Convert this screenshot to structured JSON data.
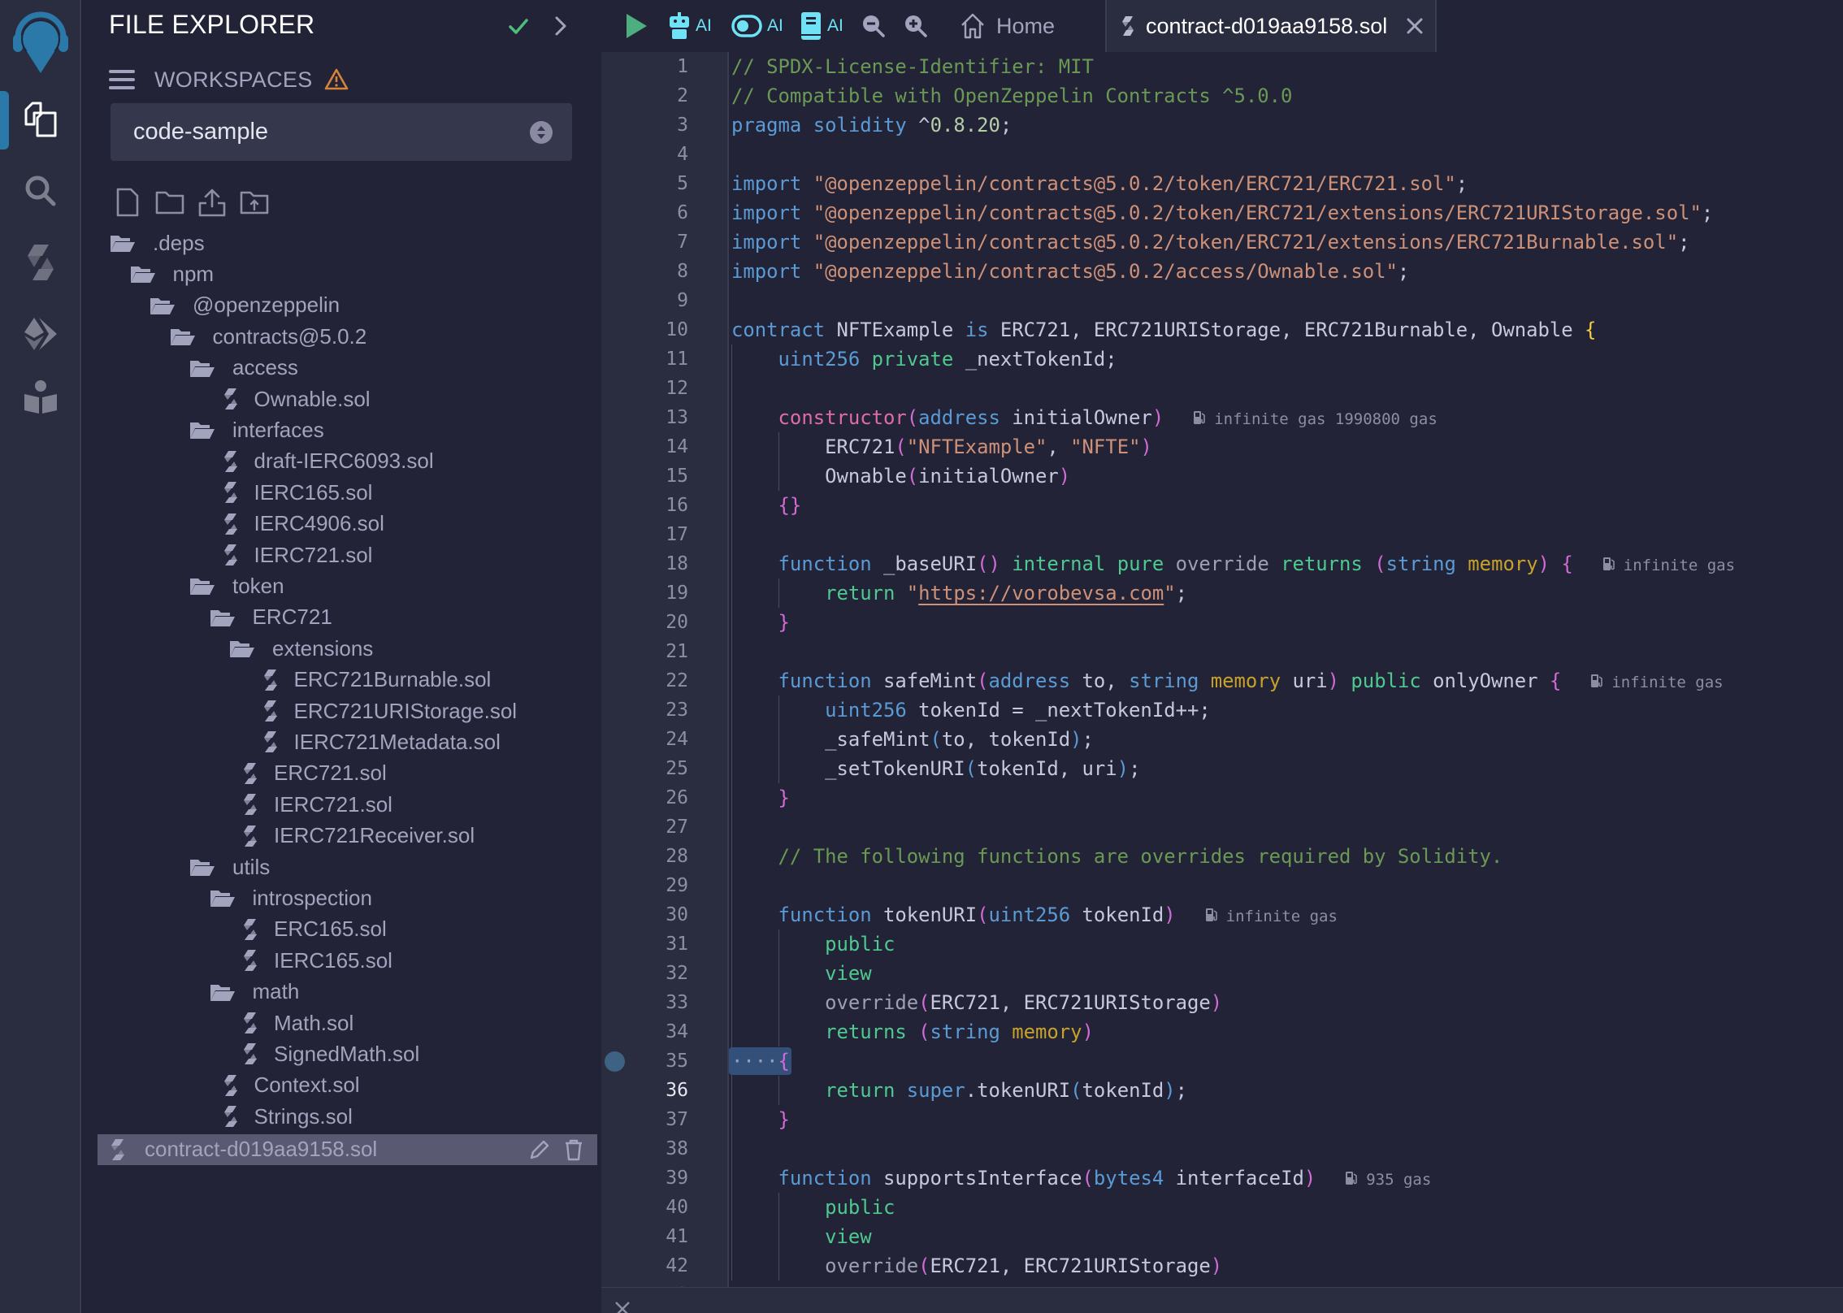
{
  "iconbar": {
    "items": [
      {
        "name": "remix-logo",
        "icon": "remix-logo-icon"
      },
      {
        "name": "file-explorer",
        "icon": "files-icon",
        "active": true
      },
      {
        "name": "search",
        "icon": "search-icon"
      },
      {
        "name": "solidity-compiler",
        "icon": "solidity-icon"
      },
      {
        "name": "deploy-run",
        "icon": "ethereum-deploy-icon"
      },
      {
        "name": "learneth",
        "icon": "learn-book-icon"
      }
    ]
  },
  "sidebar": {
    "title": "FILE EXPLORER",
    "workspaces_label": "WORKSPACES",
    "workspace_selected": "code-sample",
    "colors": {
      "warning": "#d7833a",
      "check": "#4dbd7e",
      "accent": "#2b79a8"
    },
    "file_actions": [
      "new-file",
      "new-folder",
      "upload-file",
      "upload-folder"
    ],
    "tree": [
      {
        "label": ".deps",
        "type": "folder",
        "depth": 0
      },
      {
        "label": "npm",
        "type": "folder",
        "depth": 1
      },
      {
        "label": "@openzeppelin",
        "type": "folder",
        "depth": 2
      },
      {
        "label": "contracts@5.0.2",
        "type": "folder",
        "depth": 3
      },
      {
        "label": "access",
        "type": "folder",
        "depth": 4
      },
      {
        "label": "Ownable.sol",
        "type": "file",
        "depth": 5
      },
      {
        "label": "interfaces",
        "type": "folder",
        "depth": 4
      },
      {
        "label": "draft-IERC6093.sol",
        "type": "file",
        "depth": 5
      },
      {
        "label": "IERC165.sol",
        "type": "file",
        "depth": 5
      },
      {
        "label": "IERC4906.sol",
        "type": "file",
        "depth": 5
      },
      {
        "label": "IERC721.sol",
        "type": "file",
        "depth": 5
      },
      {
        "label": "token",
        "type": "folder",
        "depth": 4
      },
      {
        "label": "ERC721",
        "type": "folder",
        "depth": 5
      },
      {
        "label": "extensions",
        "type": "folder",
        "depth": 6
      },
      {
        "label": "ERC721Burnable.sol",
        "type": "file",
        "depth": 7
      },
      {
        "label": "ERC721URIStorage.sol",
        "type": "file",
        "depth": 7
      },
      {
        "label": "IERC721Metadata.sol",
        "type": "file",
        "depth": 7
      },
      {
        "label": "ERC721.sol",
        "type": "file",
        "depth": 6
      },
      {
        "label": "IERC721.sol",
        "type": "file",
        "depth": 6
      },
      {
        "label": "IERC721Receiver.sol",
        "type": "file",
        "depth": 6
      },
      {
        "label": "utils",
        "type": "folder",
        "depth": 4
      },
      {
        "label": "introspection",
        "type": "folder",
        "depth": 5
      },
      {
        "label": "ERC165.sol",
        "type": "file",
        "depth": 6
      },
      {
        "label": "IERC165.sol",
        "type": "file",
        "depth": 6
      },
      {
        "label": "math",
        "type": "folder",
        "depth": 5
      },
      {
        "label": "Math.sol",
        "type": "file",
        "depth": 6
      },
      {
        "label": "SignedMath.sol",
        "type": "file",
        "depth": 6
      },
      {
        "label": "Context.sol",
        "type": "file",
        "depth": 5
      },
      {
        "label": "Strings.sol",
        "type": "file",
        "depth": 5
      },
      {
        "label": "contract-d019aa9158.sol",
        "type": "file",
        "depth": 0,
        "selected": true
      }
    ]
  },
  "toolbar": {
    "run_icon": "play-icon",
    "ai_buttons": [
      {
        "icon": "robot-icon",
        "label": "AI"
      },
      {
        "icon": "toggle-icon",
        "label": "AI"
      },
      {
        "icon": "book-icon",
        "label": "AI"
      }
    ],
    "zoom_out_icon": "zoom-out-icon",
    "zoom_in_icon": "zoom-in-icon",
    "home_tab": "Home",
    "active_tab": "contract-d019aa9158.sol"
  },
  "editor": {
    "current_line": 36,
    "breakpoint_line": 35,
    "gas_annotations": [
      {
        "line": 13,
        "text": "infinite gas 1990800 gas"
      },
      {
        "line": 18,
        "text": "infinite gas"
      },
      {
        "line": 22,
        "text": "infinite gas"
      },
      {
        "line": 30,
        "text": "infinite gas"
      },
      {
        "line": 39,
        "text": "935 gas"
      }
    ],
    "lines": [
      [
        [
          "cm",
          "// SPDX-License-Identifier: MIT"
        ]
      ],
      [
        [
          "cm",
          "// Compatible with OpenZeppelin Contracts ^5.0.0"
        ]
      ],
      [
        [
          "kw",
          "pragma"
        ],
        [
          "id",
          " "
        ],
        [
          "kw",
          "solidity"
        ],
        [
          "id",
          " ^"
        ],
        [
          "num",
          "0.8.20"
        ],
        [
          "id",
          ";"
        ]
      ],
      [],
      [
        [
          "kw",
          "import"
        ],
        [
          "id",
          " "
        ],
        [
          "st",
          "\"@openzeppelin/contracts@5.0.2/token/ERC721/ERC721.sol\""
        ],
        [
          "id",
          ";"
        ]
      ],
      [
        [
          "kw",
          "import"
        ],
        [
          "id",
          " "
        ],
        [
          "st",
          "\"@openzeppelin/contracts@5.0.2/token/ERC721/extensions/ERC721URIStorage.sol\""
        ],
        [
          "id",
          ";"
        ]
      ],
      [
        [
          "kw",
          "import"
        ],
        [
          "id",
          " "
        ],
        [
          "st",
          "\"@openzeppelin/contracts@5.0.2/token/ERC721/extensions/ERC721Burnable.sol\""
        ],
        [
          "id",
          ";"
        ]
      ],
      [
        [
          "kw",
          "import"
        ],
        [
          "id",
          " "
        ],
        [
          "st",
          "\"@openzeppelin/contracts@5.0.2/access/Ownable.sol\""
        ],
        [
          "id",
          ";"
        ]
      ],
      [],
      [
        [
          "kw",
          "contract"
        ],
        [
          "id",
          " NFTExample "
        ],
        [
          "kw",
          "is"
        ],
        [
          "id",
          " ERC721, ERC721URIStorage, ERC721Burnable, Ownable "
        ],
        [
          "br",
          "{"
        ]
      ],
      [
        [
          "id",
          "    "
        ],
        [
          "ty",
          "uint256"
        ],
        [
          "id",
          " "
        ],
        [
          "mod",
          "private"
        ],
        [
          "id",
          " _nextTokenId;"
        ]
      ],
      [],
      [
        [
          "id",
          "    "
        ],
        [
          "ct",
          "constructor"
        ],
        [
          "p1",
          "("
        ],
        [
          "ty",
          "address"
        ],
        [
          "id",
          " initialOwner"
        ],
        [
          "p1",
          ")"
        ]
      ],
      [
        [
          "id",
          "        ERC721"
        ],
        [
          "p1",
          "("
        ],
        [
          "st",
          "\"NFTExample\""
        ],
        [
          "id",
          ", "
        ],
        [
          "st",
          "\"NFTE\""
        ],
        [
          "p1",
          ")"
        ]
      ],
      [
        [
          "id",
          "        Ownable"
        ],
        [
          "p1",
          "("
        ],
        [
          "id",
          "initialOwner"
        ],
        [
          "p1",
          ")"
        ]
      ],
      [
        [
          "id",
          "    "
        ],
        [
          "p1",
          "{}"
        ]
      ],
      [],
      [
        [
          "id",
          "    "
        ],
        [
          "kw",
          "function"
        ],
        [
          "id",
          " _baseURI"
        ],
        [
          "p1",
          "()"
        ],
        [
          "id",
          " "
        ],
        [
          "mod",
          "internal"
        ],
        [
          "id",
          " "
        ],
        [
          "mod",
          "pure"
        ],
        [
          "id",
          " "
        ],
        [
          "ovr",
          "override"
        ],
        [
          "id",
          " "
        ],
        [
          "ret",
          "returns"
        ],
        [
          "id",
          " "
        ],
        [
          "p1",
          "("
        ],
        [
          "ty",
          "string"
        ],
        [
          "id",
          " "
        ],
        [
          "mem",
          "memory"
        ],
        [
          "p1",
          ")"
        ],
        [
          "id",
          " "
        ],
        [
          "p1",
          "{"
        ]
      ],
      [
        [
          "id",
          "        "
        ],
        [
          "ret",
          "return"
        ],
        [
          "id",
          " "
        ],
        [
          "st",
          "\""
        ],
        [
          "url",
          "https://vorobevsa.com"
        ],
        [
          "st",
          "\""
        ],
        [
          "id",
          ";"
        ]
      ],
      [
        [
          "id",
          "    "
        ],
        [
          "p1",
          "}"
        ]
      ],
      [],
      [
        [
          "id",
          "    "
        ],
        [
          "kw",
          "function"
        ],
        [
          "id",
          " safeMint"
        ],
        [
          "p1",
          "("
        ],
        [
          "ty",
          "address"
        ],
        [
          "id",
          " to, "
        ],
        [
          "ty",
          "string"
        ],
        [
          "id",
          " "
        ],
        [
          "mem",
          "memory"
        ],
        [
          "id",
          " uri"
        ],
        [
          "p1",
          ")"
        ],
        [
          "id",
          " "
        ],
        [
          "mod",
          "public"
        ],
        [
          "id",
          " onlyOwner "
        ],
        [
          "p1",
          "{"
        ]
      ],
      [
        [
          "id",
          "        "
        ],
        [
          "ty",
          "uint256"
        ],
        [
          "id",
          " tokenId = _nextTokenId++;"
        ]
      ],
      [
        [
          "id",
          "        _safeMint"
        ],
        [
          "p2",
          "("
        ],
        [
          "id",
          "to, tokenId"
        ],
        [
          "p2",
          ")"
        ],
        [
          "id",
          ";"
        ]
      ],
      [
        [
          "id",
          "        _setTokenURI"
        ],
        [
          "p2",
          "("
        ],
        [
          "id",
          "tokenId, uri"
        ],
        [
          "p2",
          ")"
        ],
        [
          "id",
          ";"
        ]
      ],
      [
        [
          "id",
          "    "
        ],
        [
          "p1",
          "}"
        ]
      ],
      [],
      [
        [
          "id",
          "    "
        ],
        [
          "cm",
          "// The following functions are overrides required by Solidity."
        ]
      ],
      [],
      [
        [
          "id",
          "    "
        ],
        [
          "kw",
          "function"
        ],
        [
          "id",
          " tokenURI"
        ],
        [
          "p1",
          "("
        ],
        [
          "ty",
          "uint256"
        ],
        [
          "id",
          " tokenId"
        ],
        [
          "p1",
          ")"
        ]
      ],
      [
        [
          "id",
          "        "
        ],
        [
          "mod",
          "public"
        ]
      ],
      [
        [
          "id",
          "        "
        ],
        [
          "mod",
          "view"
        ]
      ],
      [
        [
          "id",
          "        "
        ],
        [
          "ovr",
          "override"
        ],
        [
          "p1",
          "("
        ],
        [
          "id",
          "ERC721, ERC721URIStorage"
        ],
        [
          "p1",
          ")"
        ]
      ],
      [
        [
          "id",
          "        "
        ],
        [
          "ret",
          "returns"
        ],
        [
          "id",
          " "
        ],
        [
          "p1",
          "("
        ],
        [
          "ty",
          "string"
        ],
        [
          "id",
          " "
        ],
        [
          "mem",
          "memory"
        ],
        [
          "p1",
          ")"
        ]
      ],
      [
        [
          "ovr",
          "····"
        ],
        [
          "p1",
          "{"
        ]
      ],
      [
        [
          "id",
          "        "
        ],
        [
          "ret",
          "return"
        ],
        [
          "id",
          " "
        ],
        [
          "sup",
          "super"
        ],
        [
          "id",
          ".tokenURI"
        ],
        [
          "p2",
          "("
        ],
        [
          "id",
          "tokenId"
        ],
        [
          "p2",
          ")"
        ],
        [
          "id",
          ";"
        ]
      ],
      [
        [
          "id",
          "    "
        ],
        [
          "p1",
          "}"
        ]
      ],
      [],
      [
        [
          "id",
          "    "
        ],
        [
          "kw",
          "function"
        ],
        [
          "id",
          " supportsInterface"
        ],
        [
          "p1",
          "("
        ],
        [
          "ty",
          "bytes4"
        ],
        [
          "id",
          " interfaceId"
        ],
        [
          "p1",
          ")"
        ]
      ],
      [
        [
          "id",
          "        "
        ],
        [
          "mod",
          "public"
        ]
      ],
      [
        [
          "id",
          "        "
        ],
        [
          "mod",
          "view"
        ]
      ],
      [
        [
          "id",
          "        "
        ],
        [
          "ovr",
          "override"
        ],
        [
          "p1",
          "("
        ],
        [
          "id",
          "ERC721, ERC721URIStorage"
        ],
        [
          "p1",
          ")"
        ]
      ]
    ]
  }
}
